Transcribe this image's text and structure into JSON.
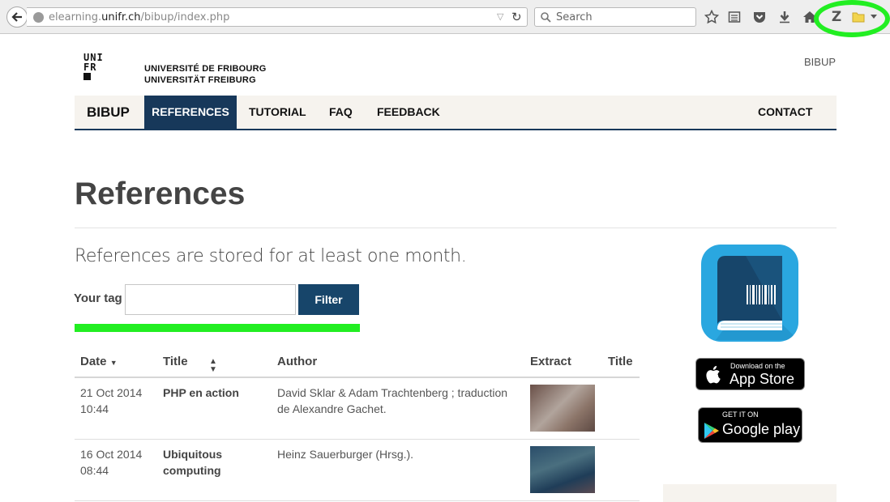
{
  "browser": {
    "url_prefix": "elearning.",
    "url_host": "unifr.ch",
    "url_path": "/bibup/index.php",
    "search_placeholder": "Search"
  },
  "header": {
    "logo_text": [
      "UNI",
      "FR"
    ],
    "university_line1": "UNIVERSITÉ DE FRIBOURG",
    "university_line2": "UNIVERSITÄT FREIBURG",
    "top_link": "BIBUP"
  },
  "nav": {
    "brand": "BIBUP",
    "items": [
      "REFERENCES",
      "TUTORIAL",
      "FAQ",
      "FEEDBACK"
    ],
    "contact": "CONTACT"
  },
  "page": {
    "title": "References",
    "intro": "References are stored for at least one month.",
    "tag_label": "Your tag",
    "tag_value": "",
    "filter_label": "Filter"
  },
  "table": {
    "headers": [
      "Date",
      "Title",
      "Author",
      "Extract",
      "Title"
    ],
    "rows": [
      {
        "date": "21 Oct 2014",
        "time": "10:44",
        "title": "PHP en action",
        "author_line1": "David Sklar & Adam Trachtenberg ; traduction",
        "author_line2": "de Alexandre Gachet."
      },
      {
        "date": "16 Oct 2014",
        "time": "08:44",
        "title_line1": "Ubiquitous",
        "title_line2": "computing",
        "author_line1": "Heinz Sauerburger (Hrsg.)."
      }
    ]
  },
  "sidebar": {
    "appstore_small": "Download on the",
    "appstore_big": "App Store",
    "gplay_small": "GET IT ON",
    "gplay_big": "Google play"
  },
  "colors": {
    "nav_active": "#17385a",
    "highlight": "#22ee22",
    "app_icon": "#2aa7e0"
  }
}
